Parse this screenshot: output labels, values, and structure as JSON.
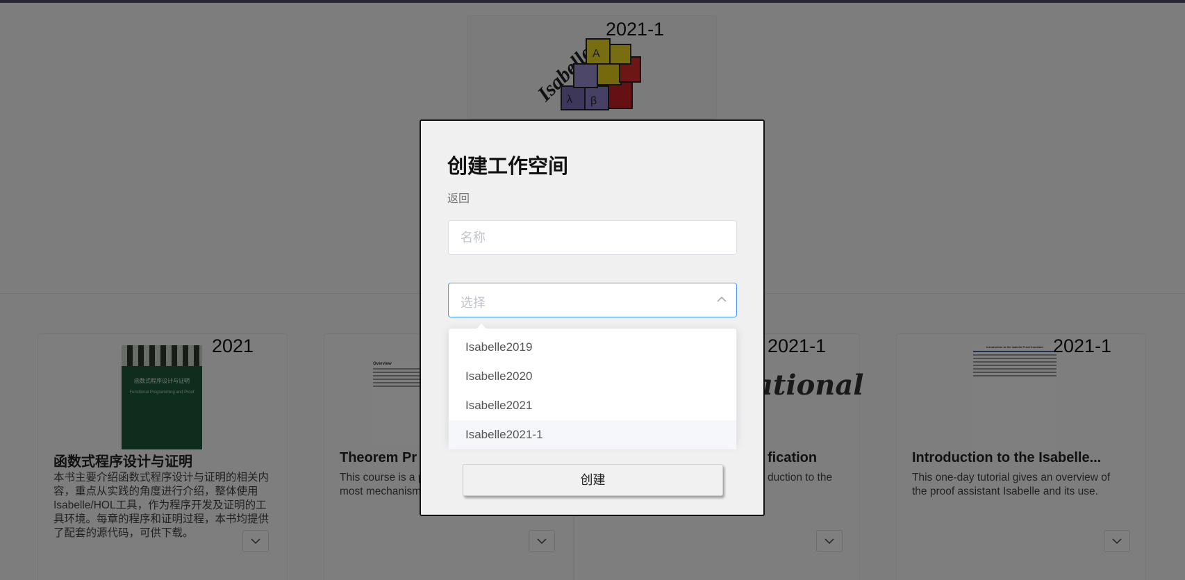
{
  "hero": {
    "version": "2021-1",
    "logo_text": "Isabelle"
  },
  "cards": [
    {
      "version": "2021",
      "title": "函数式程序设计与证明",
      "description": "本书主要介绍函数式程序设计与证明的相关内容，重点从实践的角度进行介绍，整体使用Isabelle/HOL工具，作为程序开发及证明的工具环境。每章的程序和证明过程，本书均提供了配套的源代码，可供下载。",
      "cover_title": "函数式程序设计与证明",
      "cover_subtitle": "Functional Programming and Proof"
    },
    {
      "version": "",
      "title": "Theorem Pr",
      "description": "This course is a                proving with the                covers the most                mechanisms and proof methods.",
      "thumb_heading": "Overview"
    },
    {
      "version": "2021-1",
      "title": "fication",
      "description": "duction to the",
      "banner_text": "ational"
    },
    {
      "version": "2021-1",
      "title": "Introduction to the Isabelle...",
      "description": "This one-day tutorial gives an overview of the proof assistant Isabelle and its use.",
      "thumb_heading": "Introduction to the Isabelle Proof Assistant"
    }
  ],
  "modal": {
    "title": "创建工作空间",
    "back_label": "返回",
    "name_placeholder": "名称",
    "select_placeholder": "选择",
    "options": [
      "Isabelle2019",
      "Isabelle2020",
      "Isabelle2021",
      "Isabelle2021-1"
    ],
    "hovered_option_index": 3,
    "create_label": "创建"
  },
  "colors": {
    "accent": "#409eff",
    "overlay": "rgba(0,0,0,0.5)"
  }
}
